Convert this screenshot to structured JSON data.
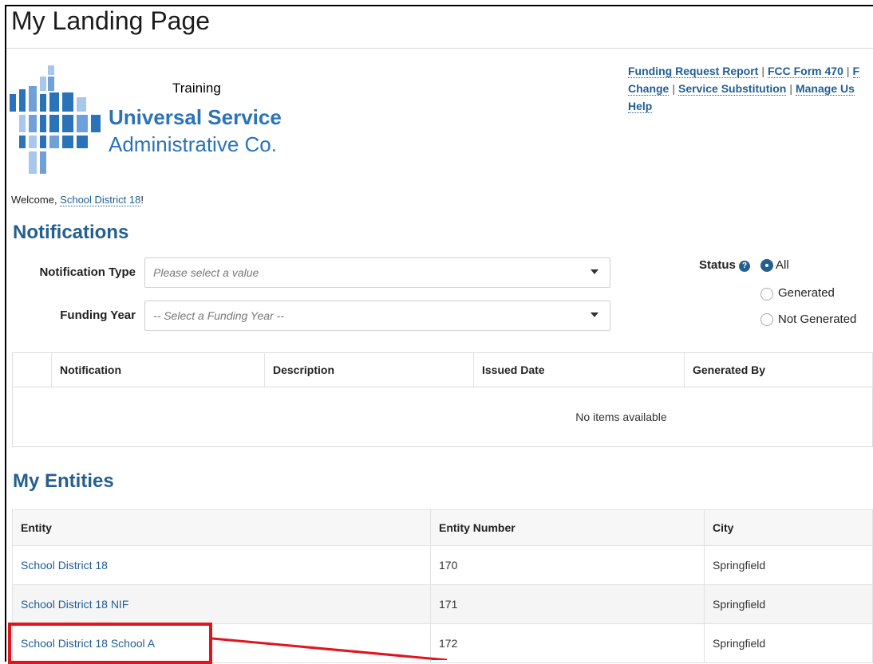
{
  "page": {
    "title": "My Landing Page"
  },
  "logo": {
    "training": "Training",
    "line1": "Universal Service",
    "line2": "Administrative Co."
  },
  "top_links": {
    "items": [
      "Funding Request Report",
      "FCC Form 470",
      "Change",
      "Service Substitution",
      "Manage Us",
      "Help"
    ],
    "separator": "|"
  },
  "welcome": {
    "prefix": "Welcome, ",
    "user": "School District 18",
    "suffix": "!"
  },
  "notifications": {
    "title": "Notifications",
    "notification_type_label": "Notification Type",
    "notification_type_placeholder": "Please select a value",
    "funding_year_label": "Funding Year",
    "funding_year_placeholder": "-- Select a Funding Year --",
    "status_label": "Status",
    "status_options": [
      "All",
      "Generated",
      "Not Generated"
    ],
    "status_selected": "All",
    "columns": [
      "Notification",
      "Description",
      "Issued Date",
      "Generated By"
    ],
    "empty_text": "No items available"
  },
  "entities": {
    "title": "My Entities",
    "columns": [
      "Entity",
      "Entity Number",
      "City"
    ],
    "rows": [
      {
        "entity": "School District 18",
        "number": "170",
        "city": "Springfield"
      },
      {
        "entity": "School District 18 NIF",
        "number": "171",
        "city": "Springfield"
      },
      {
        "entity": "School District 18 School A",
        "number": "172",
        "city": "Springfield"
      }
    ]
  },
  "colors": {
    "accent": "#245f8f",
    "link": "#1f5e95",
    "highlight": "#e0141e",
    "logo_blue": "#2a73b8"
  }
}
